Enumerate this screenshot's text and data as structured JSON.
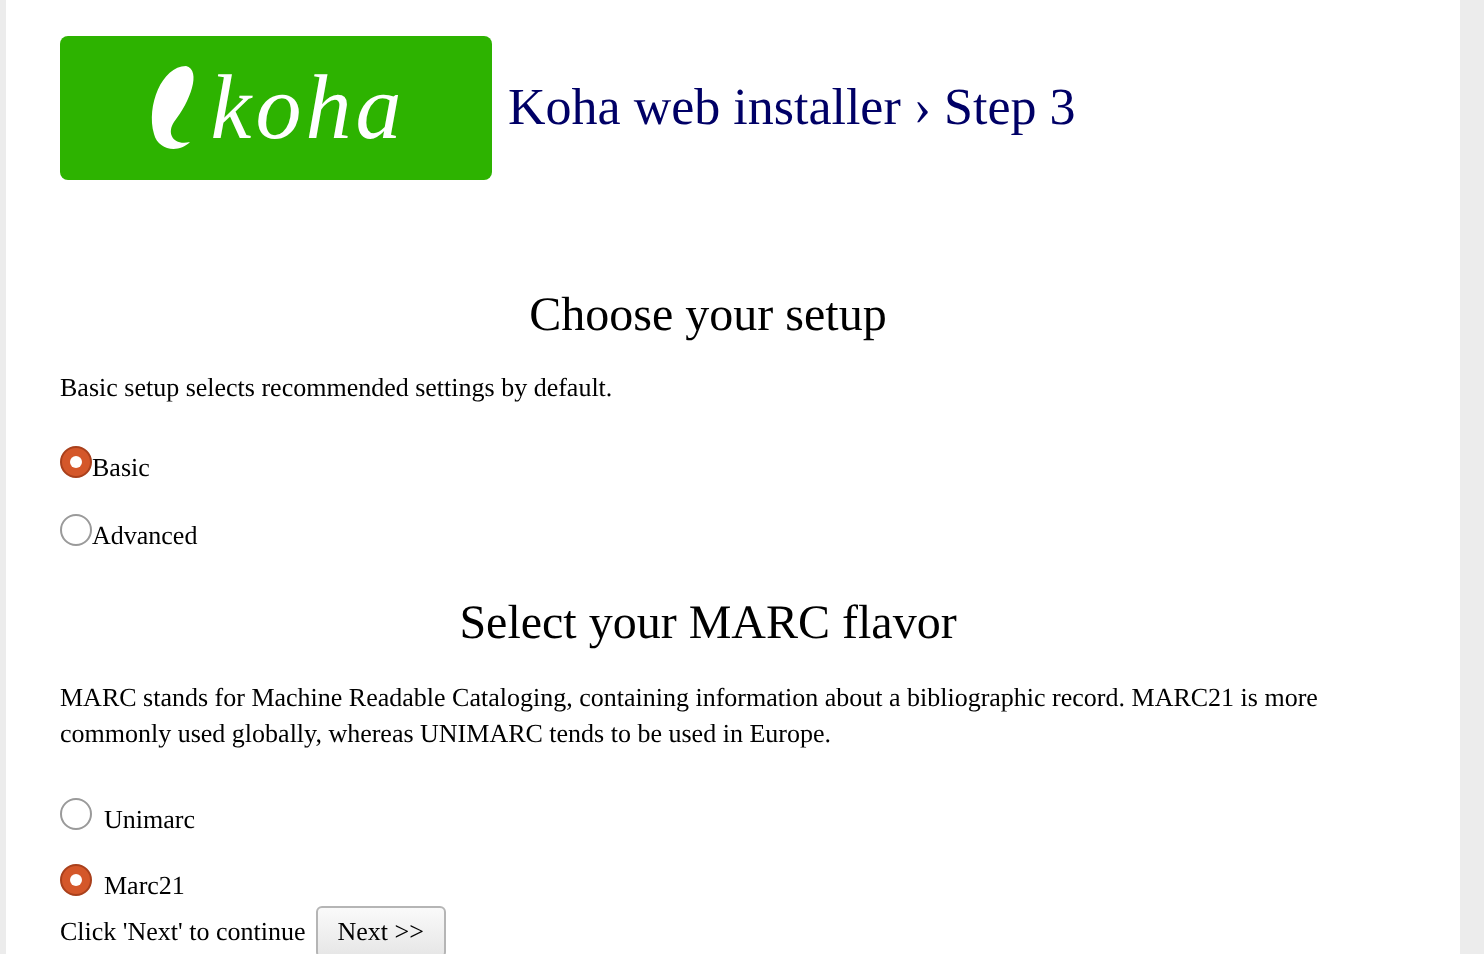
{
  "logo": {
    "text": "koha"
  },
  "title": "Koha web installer › Step 3",
  "setup": {
    "heading": "Choose your setup",
    "description": "Basic setup selects recommended settings by default.",
    "options": [
      {
        "label": "Basic",
        "selected": true
      },
      {
        "label": "Advanced",
        "selected": false
      }
    ]
  },
  "marc": {
    "heading": "Select your MARC flavor",
    "description": "MARC stands for Machine Readable Cataloging, containing information about a bibliographic record. MARC21 is more commonly used globally, whereas UNIMARC tends to be used in Europe.",
    "options": [
      {
        "label": "Unimarc",
        "selected": false
      },
      {
        "label": "Marc21",
        "selected": true
      }
    ]
  },
  "footer": {
    "prompt": "Click 'Next' to continue",
    "button": "Next >>"
  }
}
